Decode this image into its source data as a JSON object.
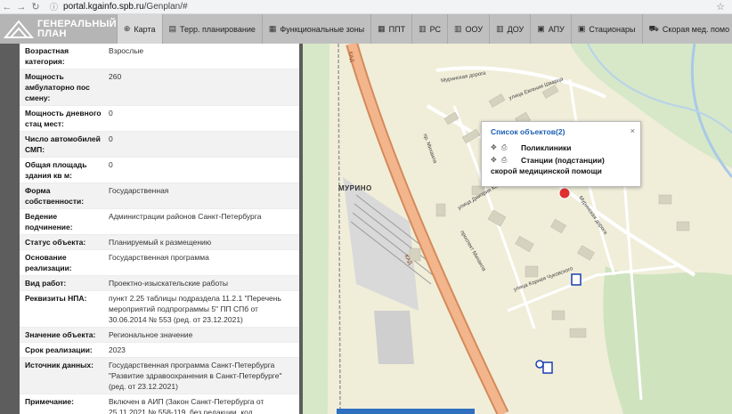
{
  "browser": {
    "back": "←",
    "forward": "→",
    "reload": "↻",
    "url_host": "portal.kgainfo.spb.ru",
    "url_path": "/Genplan/#"
  },
  "app": {
    "logo_line1": "ГЕНЕРАЛЬНЫЙ",
    "logo_line2": "ПЛАН",
    "tabs": [
      {
        "label": "Карта",
        "icon": "globe-icon",
        "glyph": "⊕"
      },
      {
        "label": "Терр. планирование",
        "icon": "document-icon",
        "glyph": "▤"
      },
      {
        "label": "Функциональные зоны",
        "icon": "layers-icon",
        "glyph": "▦"
      },
      {
        "label": "ППТ",
        "icon": "grid-icon",
        "glyph": "▦"
      },
      {
        "label": "РС",
        "icon": "file-icon",
        "glyph": "▥"
      },
      {
        "label": "ООУ",
        "icon": "book-icon",
        "glyph": "▥"
      },
      {
        "label": "ДОУ",
        "icon": "book-icon",
        "glyph": "▥"
      },
      {
        "label": "АПУ",
        "icon": "monitor-icon",
        "glyph": "▣"
      },
      {
        "label": "Стационары",
        "icon": "hospital-icon",
        "glyph": "▣"
      },
      {
        "label": "Скорая мед. помо",
        "icon": "ambulance-icon",
        "glyph": "⛟"
      }
    ]
  },
  "info": {
    "rows": [
      {
        "key": "Возрастная категория:",
        "value": "Взрослые"
      },
      {
        "key": "Мощность амбулаторно пос смену:",
        "value": "260"
      },
      {
        "key": "Мощность дневного стац мест:",
        "value": "0"
      },
      {
        "key": "Число автомобилей СМП:",
        "value": "0"
      },
      {
        "key": "Общая площадь здания кв м:",
        "value": "0"
      },
      {
        "key": "Форма собственности:",
        "value": "Государственная"
      },
      {
        "key": "Ведение подчинение:",
        "value": "Администрации районов Санкт-Петербурга"
      },
      {
        "key": "Статус объекта:",
        "value": "Планируемый к размещению"
      },
      {
        "key": "Основание реализации:",
        "value": "Государственная программа"
      },
      {
        "key": "Вид работ:",
        "value": "Проектно-изыскательские работы"
      },
      {
        "key": "Реквизиты НПА:",
        "value": "пункт 2.25 таблицы подраздела 11.2.1 \"Перечень мероприятий подпрограммы 5\" ПП СПб от 30.06.2014 № 553 (ред. от 23.12.2021)"
      },
      {
        "key": "Значение объекта:",
        "value": "Региональное значение"
      },
      {
        "key": "Срок реализации:",
        "value": "2023"
      },
      {
        "key": "Источник данных:",
        "value": "Государственная программа Санкт-Петербурга \"Развитие здравоохранения в Санкт-Петербурге\" (ред. от 23.12.2021)"
      },
      {
        "key": "Примечание:",
        "value": "Включен в АИП (Закон Санкт-Петербурга от 25.11.2021 № 558-119, без редакции, код"
      }
    ]
  },
  "map": {
    "town": "МУРИНО",
    "road_kad": "КАД",
    "streets": [
      "Муринская дорога",
      "улица Евгения Шварца",
      "пр. Михаила",
      "улица Дмитрия Ковалёва",
      "улица Корнея Чуковского",
      "проспект Михаила",
      "Муринская дорога"
    ],
    "popup": {
      "title": "Список объектов(2)",
      "close": "×",
      "item1": "Поликлиники",
      "item2_line1": "Станции (подстанции)",
      "item2_line2": "скорой медицинской помощи"
    }
  },
  "colors": {
    "header_bg": "#bfbfbf",
    "panel_bg": "#5d5d5d",
    "map_bg": "#f0eed9",
    "popup_title": "#1a5fb4",
    "kad_road": "#e8a97e"
  }
}
